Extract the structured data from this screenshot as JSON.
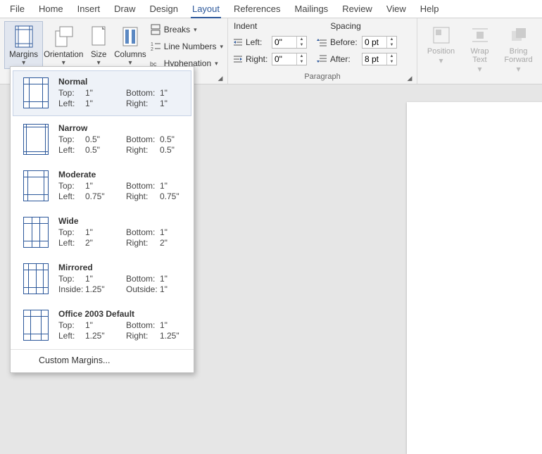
{
  "tabs": [
    "File",
    "Home",
    "Insert",
    "Draw",
    "Design",
    "Layout",
    "References",
    "Mailings",
    "Review",
    "View",
    "Help"
  ],
  "active_tab": "Layout",
  "ribbon": {
    "pagesetup": {
      "margins": "Margins",
      "orientation": "Orientation",
      "size": "Size",
      "columns": "Columns",
      "breaks": "Breaks",
      "line_numbers": "Line Numbers",
      "hyphenation": "Hyphenation"
    },
    "paragraph": {
      "title_indent": "Indent",
      "title_spacing": "Spacing",
      "left": "Left:",
      "right": "Right:",
      "before": "Before:",
      "after": "After:",
      "val_left": "0\"",
      "val_right": "0\"",
      "val_before": "0 pt",
      "val_after": "8 pt",
      "group_label": "Paragraph"
    },
    "arrange": {
      "position": "Position",
      "wrap": "Wrap\nText",
      "bring": "Bring\nForward"
    }
  },
  "presets": [
    {
      "name": "Normal",
      "l1a": "Top:",
      "l1b": "1\"",
      "l1c": "Bottom:",
      "l1d": "1\"",
      "l2a": "Left:",
      "l2b": "1\"",
      "l2c": "Right:",
      "l2d": "1\"",
      "sel": true,
      "style": "normal"
    },
    {
      "name": "Narrow",
      "l1a": "Top:",
      "l1b": "0.5\"",
      "l1c": "Bottom:",
      "l1d": "0.5\"",
      "l2a": "Left:",
      "l2b": "0.5\"",
      "l2c": "Right:",
      "l2d": "0.5\"",
      "sel": false,
      "style": "narrow"
    },
    {
      "name": "Moderate",
      "l1a": "Top:",
      "l1b": "1\"",
      "l1c": "Bottom:",
      "l1d": "1\"",
      "l2a": "Left:",
      "l2b": "0.75\"",
      "l2c": "Right:",
      "l2d": "0.75\"",
      "sel": false,
      "style": "moderate"
    },
    {
      "name": "Wide",
      "l1a": "Top:",
      "l1b": "1\"",
      "l1c": "Bottom:",
      "l1d": "1\"",
      "l2a": "Left:",
      "l2b": "2\"",
      "l2c": "Right:",
      "l2d": "2\"",
      "sel": false,
      "style": "wide"
    },
    {
      "name": "Mirrored",
      "l1a": "Top:",
      "l1b": "1\"",
      "l1c": "Bottom:",
      "l1d": "1\"",
      "l2a": "Inside:",
      "l2b": "1.25\"",
      "l2c": "Outside:",
      "l2d": "1\"",
      "sel": false,
      "style": "mirrored"
    },
    {
      "name": "Office 2003 Default",
      "l1a": "Top:",
      "l1b": "1\"",
      "l1c": "Bottom:",
      "l1d": "1\"",
      "l2a": "Left:",
      "l2b": "1.25\"",
      "l2c": "Right:",
      "l2d": "1.25\"",
      "sel": false,
      "style": "o2003"
    }
  ],
  "custom_margins": "Custom Margins..."
}
